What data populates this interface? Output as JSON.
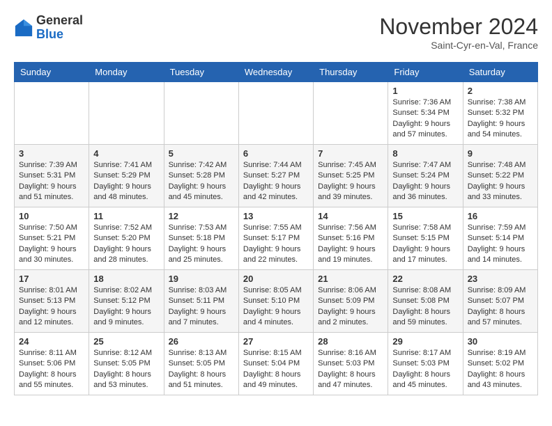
{
  "header": {
    "logo_general": "General",
    "logo_blue": "Blue",
    "month_title": "November 2024",
    "location": "Saint-Cyr-en-Val, France"
  },
  "weekdays": [
    "Sunday",
    "Monday",
    "Tuesday",
    "Wednesday",
    "Thursday",
    "Friday",
    "Saturday"
  ],
  "weeks": [
    [
      {
        "day": "",
        "info": ""
      },
      {
        "day": "",
        "info": ""
      },
      {
        "day": "",
        "info": ""
      },
      {
        "day": "",
        "info": ""
      },
      {
        "day": "",
        "info": ""
      },
      {
        "day": "1",
        "info": "Sunrise: 7:36 AM\nSunset: 5:34 PM\nDaylight: 9 hours and 57 minutes."
      },
      {
        "day": "2",
        "info": "Sunrise: 7:38 AM\nSunset: 5:32 PM\nDaylight: 9 hours and 54 minutes."
      }
    ],
    [
      {
        "day": "3",
        "info": "Sunrise: 7:39 AM\nSunset: 5:31 PM\nDaylight: 9 hours and 51 minutes."
      },
      {
        "day": "4",
        "info": "Sunrise: 7:41 AM\nSunset: 5:29 PM\nDaylight: 9 hours and 48 minutes."
      },
      {
        "day": "5",
        "info": "Sunrise: 7:42 AM\nSunset: 5:28 PM\nDaylight: 9 hours and 45 minutes."
      },
      {
        "day": "6",
        "info": "Sunrise: 7:44 AM\nSunset: 5:27 PM\nDaylight: 9 hours and 42 minutes."
      },
      {
        "day": "7",
        "info": "Sunrise: 7:45 AM\nSunset: 5:25 PM\nDaylight: 9 hours and 39 minutes."
      },
      {
        "day": "8",
        "info": "Sunrise: 7:47 AM\nSunset: 5:24 PM\nDaylight: 9 hours and 36 minutes."
      },
      {
        "day": "9",
        "info": "Sunrise: 7:48 AM\nSunset: 5:22 PM\nDaylight: 9 hours and 33 minutes."
      }
    ],
    [
      {
        "day": "10",
        "info": "Sunrise: 7:50 AM\nSunset: 5:21 PM\nDaylight: 9 hours and 30 minutes."
      },
      {
        "day": "11",
        "info": "Sunrise: 7:52 AM\nSunset: 5:20 PM\nDaylight: 9 hours and 28 minutes."
      },
      {
        "day": "12",
        "info": "Sunrise: 7:53 AM\nSunset: 5:18 PM\nDaylight: 9 hours and 25 minutes."
      },
      {
        "day": "13",
        "info": "Sunrise: 7:55 AM\nSunset: 5:17 PM\nDaylight: 9 hours and 22 minutes."
      },
      {
        "day": "14",
        "info": "Sunrise: 7:56 AM\nSunset: 5:16 PM\nDaylight: 9 hours and 19 minutes."
      },
      {
        "day": "15",
        "info": "Sunrise: 7:58 AM\nSunset: 5:15 PM\nDaylight: 9 hours and 17 minutes."
      },
      {
        "day": "16",
        "info": "Sunrise: 7:59 AM\nSunset: 5:14 PM\nDaylight: 9 hours and 14 minutes."
      }
    ],
    [
      {
        "day": "17",
        "info": "Sunrise: 8:01 AM\nSunset: 5:13 PM\nDaylight: 9 hours and 12 minutes."
      },
      {
        "day": "18",
        "info": "Sunrise: 8:02 AM\nSunset: 5:12 PM\nDaylight: 9 hours and 9 minutes."
      },
      {
        "day": "19",
        "info": "Sunrise: 8:03 AM\nSunset: 5:11 PM\nDaylight: 9 hours and 7 minutes."
      },
      {
        "day": "20",
        "info": "Sunrise: 8:05 AM\nSunset: 5:10 PM\nDaylight: 9 hours and 4 minutes."
      },
      {
        "day": "21",
        "info": "Sunrise: 8:06 AM\nSunset: 5:09 PM\nDaylight: 9 hours and 2 minutes."
      },
      {
        "day": "22",
        "info": "Sunrise: 8:08 AM\nSunset: 5:08 PM\nDaylight: 8 hours and 59 minutes."
      },
      {
        "day": "23",
        "info": "Sunrise: 8:09 AM\nSunset: 5:07 PM\nDaylight: 8 hours and 57 minutes."
      }
    ],
    [
      {
        "day": "24",
        "info": "Sunrise: 8:11 AM\nSunset: 5:06 PM\nDaylight: 8 hours and 55 minutes."
      },
      {
        "day": "25",
        "info": "Sunrise: 8:12 AM\nSunset: 5:05 PM\nDaylight: 8 hours and 53 minutes."
      },
      {
        "day": "26",
        "info": "Sunrise: 8:13 AM\nSunset: 5:05 PM\nDaylight: 8 hours and 51 minutes."
      },
      {
        "day": "27",
        "info": "Sunrise: 8:15 AM\nSunset: 5:04 PM\nDaylight: 8 hours and 49 minutes."
      },
      {
        "day": "28",
        "info": "Sunrise: 8:16 AM\nSunset: 5:03 PM\nDaylight: 8 hours and 47 minutes."
      },
      {
        "day": "29",
        "info": "Sunrise: 8:17 AM\nSunset: 5:03 PM\nDaylight: 8 hours and 45 minutes."
      },
      {
        "day": "30",
        "info": "Sunrise: 8:19 AM\nSunset: 5:02 PM\nDaylight: 8 hours and 43 minutes."
      }
    ]
  ]
}
